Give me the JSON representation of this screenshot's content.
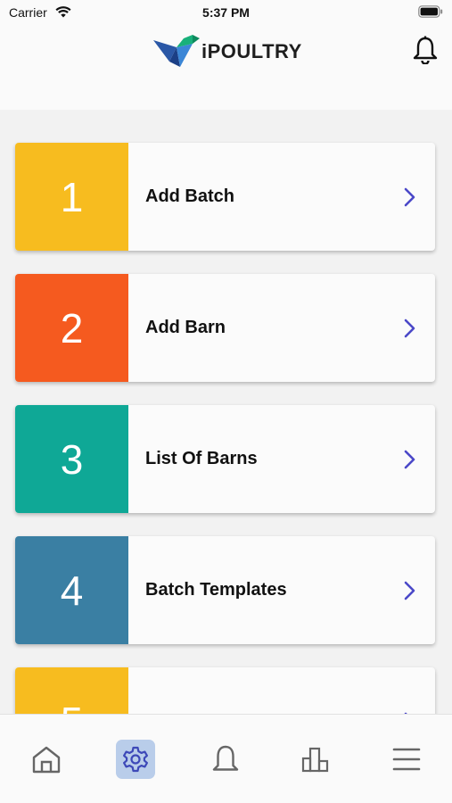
{
  "status_bar": {
    "carrier": "Carrier",
    "time": "5:37 PM"
  },
  "header": {
    "app_name": "iPOULTRY",
    "icons": [
      "logo-bird",
      "bell-icon"
    ]
  },
  "menu": {
    "items": [
      {
        "number": "1",
        "label": "Add Batch",
        "color": "#f7bc1f"
      },
      {
        "number": "2",
        "label": "Add Barn",
        "color": "#f55a1f"
      },
      {
        "number": "3",
        "label": "List Of Barns",
        "color": "#0fa896"
      },
      {
        "number": "4",
        "label": "Batch Templates",
        "color": "#3a7fa3"
      },
      {
        "number": "5",
        "label": "",
        "color": "#f7bc1f"
      }
    ],
    "chevron_color": "#4b48c8"
  },
  "tab_bar": {
    "tabs": [
      "home-icon",
      "settings-icon",
      "bell-icon",
      "reports-icon",
      "menu-icon"
    ],
    "active": "settings-icon"
  }
}
